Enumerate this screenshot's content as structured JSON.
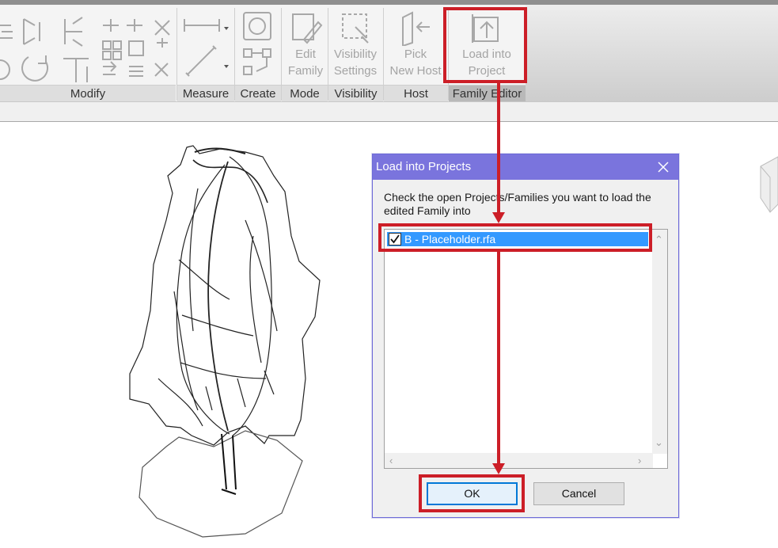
{
  "ribbon": {
    "panels": {
      "modify": "Modify",
      "measure": "Measure",
      "create": "Create",
      "mode": "Mode",
      "visibility": "Visibility",
      "host": "Host",
      "family_editor": "Family Editor"
    },
    "tools": {
      "edit_family_line1": "Edit",
      "edit_family_line2": "Family",
      "visibility_settings_line1": "Visibility",
      "visibility_settings_line2": "Settings",
      "pick_new_host_line1": "Pick",
      "pick_new_host_line2": "New Host",
      "load_into_project_line1": "Load into",
      "load_into_project_line2": "Project"
    }
  },
  "dialog": {
    "title": "Load into Projects",
    "close_icon": "close-icon",
    "message": "Check the open Projects/Families you want to load the edited Family into",
    "items": [
      {
        "label": "B - Placeholder.rfa",
        "checked": true,
        "selected": true
      }
    ],
    "ok_label": "OK",
    "cancel_label": "Cancel"
  },
  "annotations": {
    "highlight_color": "#cc1e27"
  },
  "colors": {
    "dialog_titlebar": "#7a74dd",
    "selection": "#3399ff"
  }
}
